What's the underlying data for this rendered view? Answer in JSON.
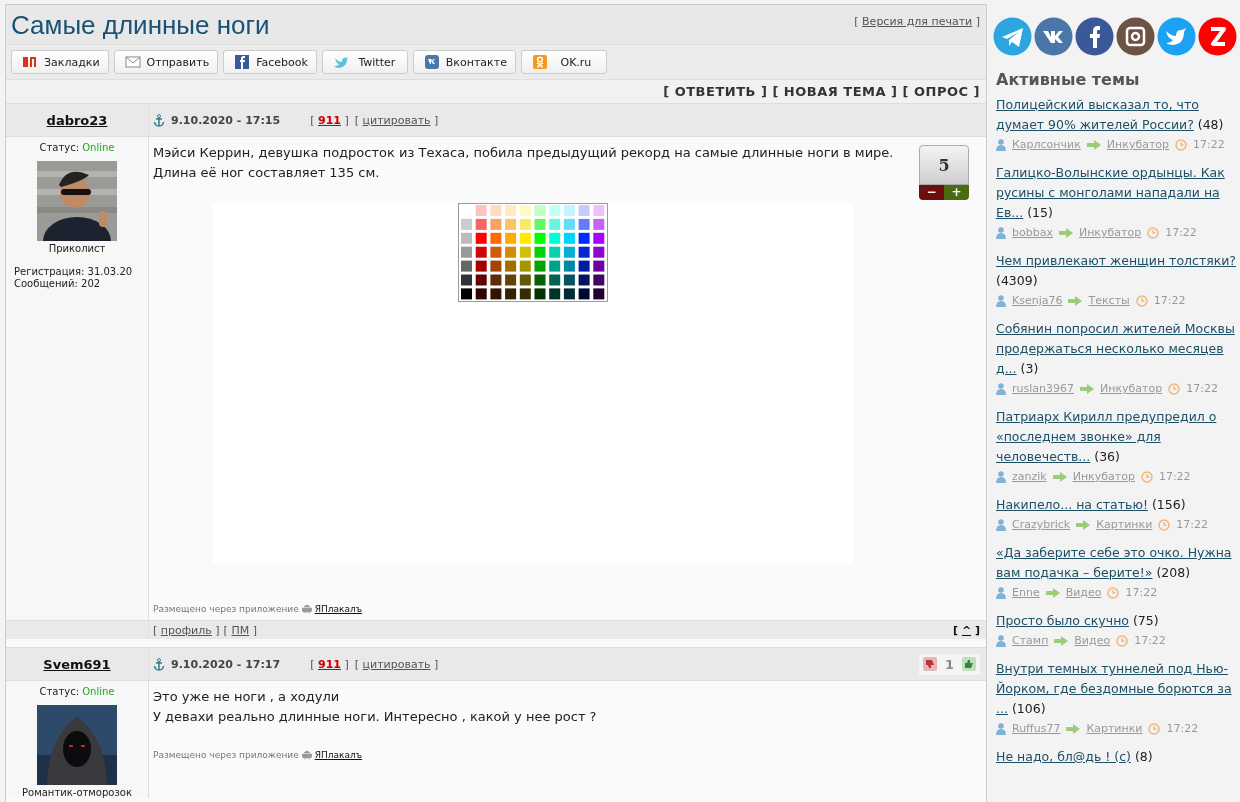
{
  "page": {
    "title": "Самые длинные ноги",
    "print_link": {
      "open": "[",
      "text": "Версия для печати",
      "close": "]"
    }
  },
  "share_buttons": [
    {
      "label": "Закладки",
      "kind": "yp"
    },
    {
      "label": "Отправить",
      "kind": "mail"
    },
    {
      "label": "Facebook",
      "kind": "facebook"
    },
    {
      "label": "Twitter",
      "kind": "twitter"
    },
    {
      "label": "Вконтакте",
      "kind": "vk"
    },
    {
      "label": "OK.ru",
      "kind": "ok"
    }
  ],
  "actions": [
    "[ ОТВЕТИТЬ ]",
    "[ НОВАЯ ТЕМА ]",
    "[ ОПРОС ]"
  ],
  "posts": [
    {
      "author": "dabro23",
      "status_label": "Статус:",
      "status": "Online",
      "rank": "Приколист",
      "registration": "Регистрация: 31.03.20",
      "messages": "Сообщений: 202",
      "date": "9.10.2020 - 17:15",
      "links": [
        {
          "open": "[",
          "text": "911",
          "close": "]",
          "kind": "number"
        },
        {
          "open": "[",
          "text": "цитировать",
          "close": "]",
          "kind": "quote"
        }
      ],
      "lines": [
        "Мэйси Керрин, девушка подросток из Техаса, побила предыдущий рекорд на самые длинные ноги в мире.",
        "Длина её ног составляет 135 см."
      ],
      "image": true,
      "via": "Размещено через приложение",
      "app": "ЯПлакалъ",
      "rating": {
        "kind": "box",
        "value": "5",
        "minus": "−",
        "plus": "+"
      },
      "footer_links": [
        {
          "open": "[",
          "text": "профиль",
          "close": "]"
        },
        {
          "open": "[",
          "text": "ПМ",
          "close": "]"
        }
      ],
      "top_link": {
        "open": "[",
        "text": "^",
        "close": "]"
      }
    },
    {
      "author": "Svem691",
      "status_label": "Статус:",
      "status": "Online",
      "rank": "Романтик-отморозок",
      "date": "9.10.2020 - 17:17",
      "links": [
        {
          "open": "[",
          "text": "911",
          "close": "]",
          "kind": "number"
        },
        {
          "open": "[",
          "text": "цитировать",
          "close": "]",
          "kind": "quote"
        }
      ],
      "lines": [
        "Это уже не ноги , а ходули",
        "У девахи реально длинные ноги. Интересно , какой у нее рост ?"
      ],
      "image": false,
      "via": "Размещено через приложение",
      "app": "ЯПлакалъ",
      "rating": {
        "kind": "thumbs",
        "value": "1"
      }
    }
  ],
  "sidebar": {
    "heading": "Активные темы",
    "topics": [
      {
        "title": "Полицейский высказал то, что думает 90% жителей России?",
        "count": "(48)",
        "user": "Карлсончик",
        "category": "Инкубатор",
        "time": "17:22"
      },
      {
        "title": "Галицко-Волынские ордынцы. Как русины с монголами нападали на Ев...",
        "count": "(15)",
        "user": "bobbax",
        "category": "Инкубатор",
        "time": "17:22"
      },
      {
        "title": "Чем привлекают женщин толстяки?",
        "count": "(4309)",
        "user": "Ksenja76",
        "category": "Тексты",
        "time": "17:22"
      },
      {
        "title": "Собянин попросил жителей Москвы продержаться несколько месяцев д...",
        "count": "(3)",
        "user": "ruslan3967",
        "category": "Инкубатор",
        "time": "17:22"
      },
      {
        "title": "Патриарх Кирилл предупредил о «последнем звонке» для человечеств...",
        "count": "(36)",
        "user": "zanzik",
        "category": "Инкубатор",
        "time": "17:22"
      },
      {
        "title": "Накипело... на статью!",
        "count": "(156)",
        "user": "Crazybrick",
        "category": "Картинки",
        "time": "17:22"
      },
      {
        "title": "«Да заберите себе это очко. Нужна вам подачка – берите!»",
        "count": "(208)",
        "user": "Enne",
        "category": "Видео",
        "time": "17:22"
      },
      {
        "title": "Просто было скучно",
        "count": "(75)",
        "user": "Стамп",
        "category": "Видео",
        "time": "17:22"
      },
      {
        "title": "Внутри темных туннелей под Нью-Йорком, где бездомные борются за ...",
        "count": "(106)",
        "user": "Ruffus77",
        "category": "Картинки",
        "time": "17:22"
      },
      {
        "title": "Не надо, бл@дь ! (с)",
        "count": "(8)"
      }
    ]
  }
}
